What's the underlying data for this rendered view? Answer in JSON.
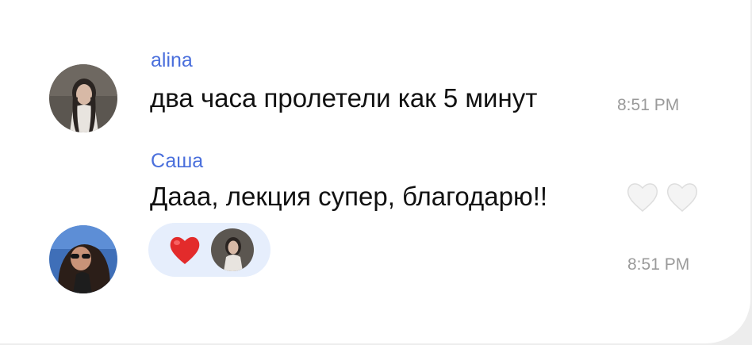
{
  "messages": [
    {
      "author": "alina",
      "text": "два часа пролетели как 5 минут",
      "time": "8:51 PM",
      "avatar_icon": "user-avatar-alina"
    },
    {
      "author": "Саша",
      "text": "Дааа, лекция супер, благодарю!!",
      "time": "8:51 PM",
      "avatar_icon": "user-avatar-sasha",
      "trailing_emoji": [
        "white-heart-icon",
        "white-heart-icon"
      ],
      "reaction": {
        "emoji": "red-heart-icon",
        "reactor_avatar": "user-avatar-alina"
      }
    }
  ],
  "colors": {
    "author_name": "#4a6fdc",
    "reaction_bg": "#e6eefc",
    "time": "#9a9a9a"
  }
}
